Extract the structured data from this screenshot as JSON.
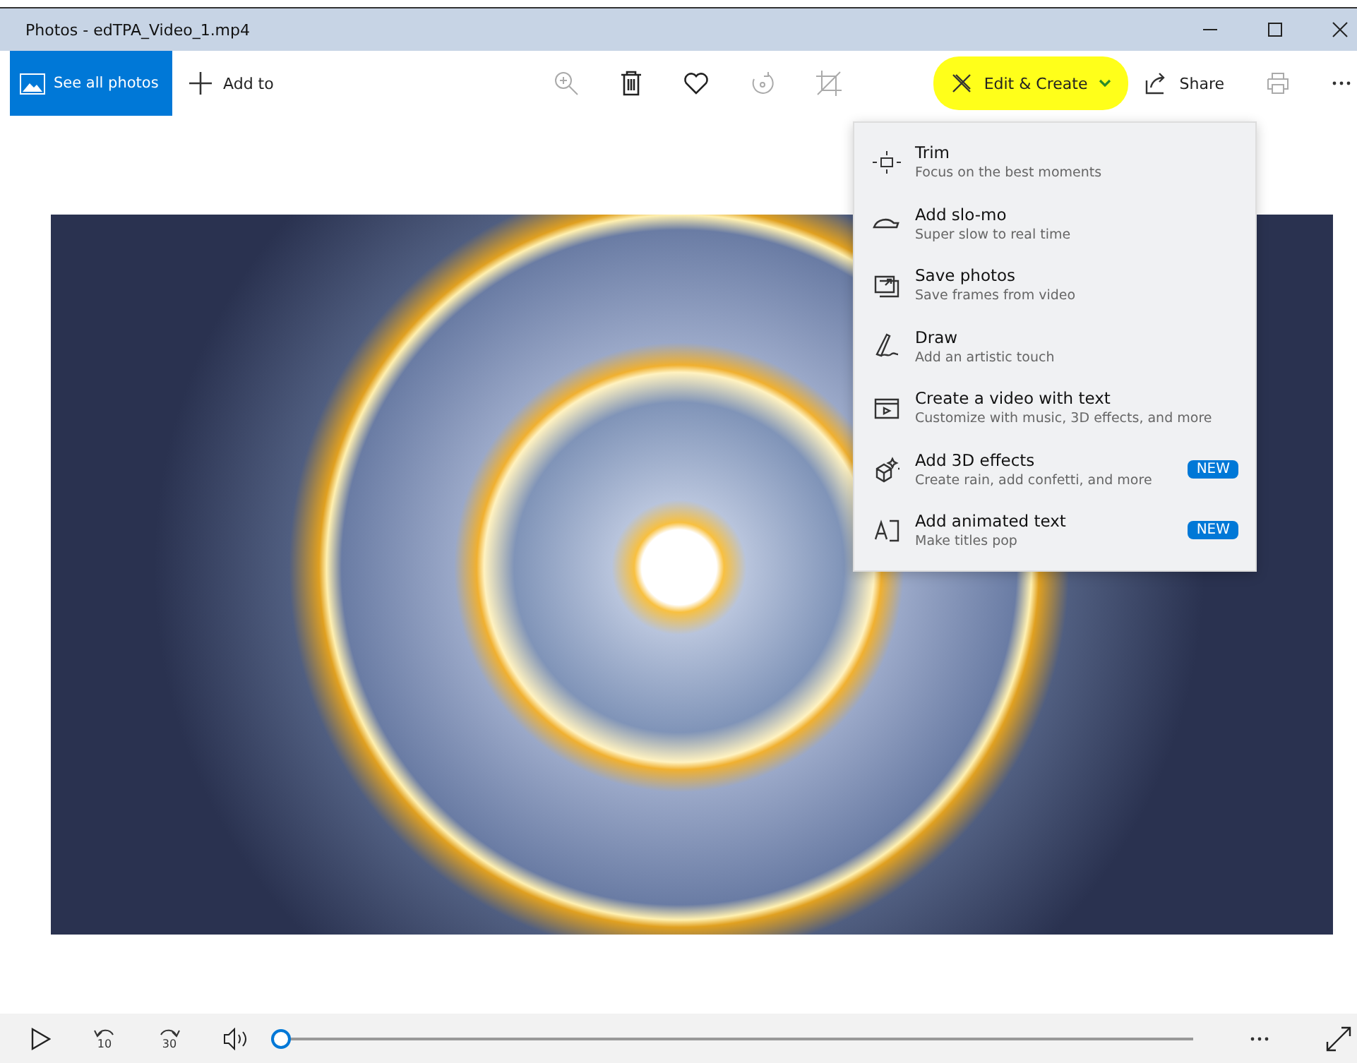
{
  "window": {
    "title": "Photos - edTPA_Video_1.mp4"
  },
  "toolbar": {
    "see_all": "See all photos",
    "add_to": "Add to",
    "edit_create": {
      "label": "Edit & Create",
      "highlighted": true,
      "expanded": true
    },
    "share": "Share"
  },
  "edit_menu": [
    {
      "kind": "trim",
      "title": "Trim",
      "subtitle": "Focus on the best moments"
    },
    {
      "kind": "slomo",
      "title": "Add slo-mo",
      "subtitle": "Super slow to real time"
    },
    {
      "kind": "save",
      "title": "Save photos",
      "subtitle": "Save frames from video"
    },
    {
      "kind": "draw",
      "title": "Draw",
      "subtitle": "Add an artistic touch"
    },
    {
      "kind": "video",
      "title": "Create a video with text",
      "subtitle": "Customize with music, 3D effects, and more"
    },
    {
      "kind": "effects",
      "title": "Add 3D effects",
      "subtitle": "Create rain, add confetti, and more",
      "badge": "NEW"
    },
    {
      "kind": "text",
      "title": "Add animated text",
      "subtitle": "Make titles pop",
      "badge": "NEW"
    }
  ],
  "player": {
    "skip_back": "10",
    "skip_forward": "30",
    "seek": {
      "level": 0
    }
  }
}
